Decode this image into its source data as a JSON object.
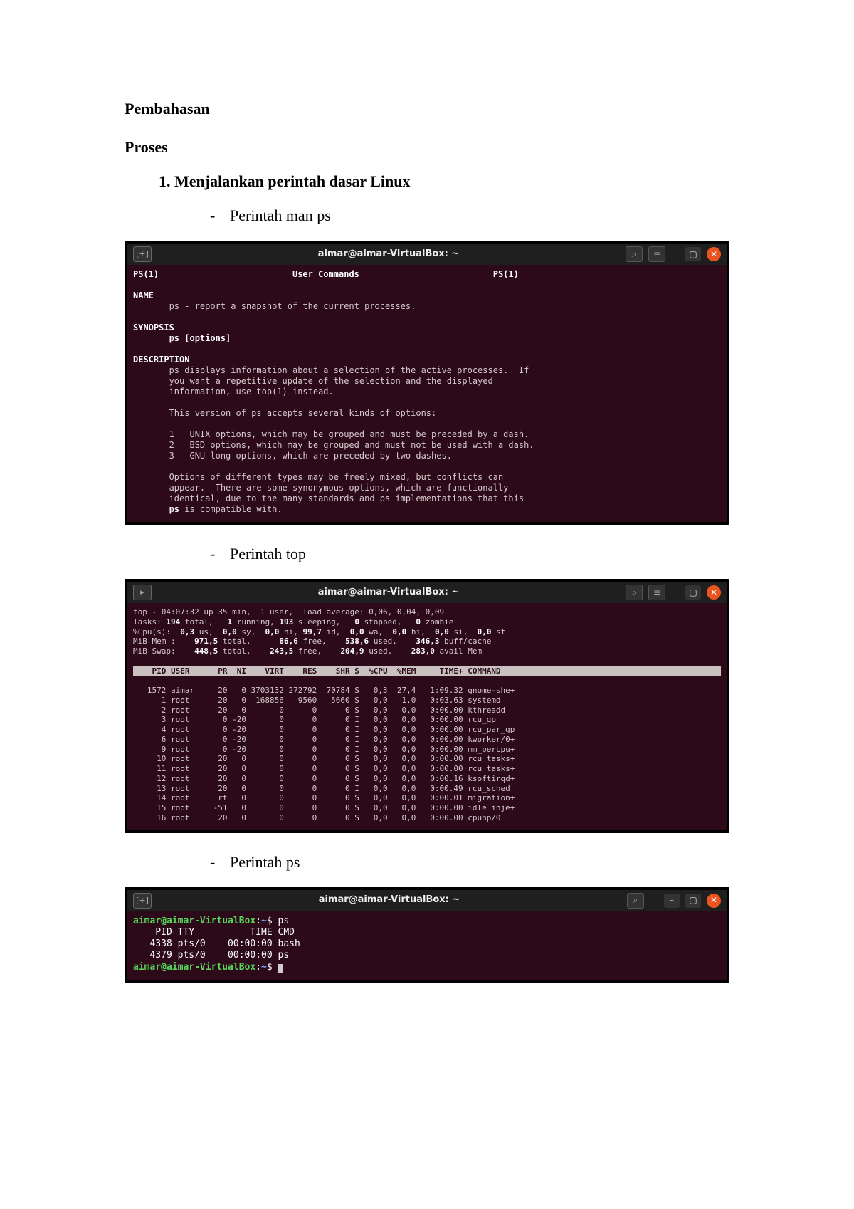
{
  "page": {
    "title": "Pembahasan",
    "subtitle": "Proses",
    "item1": "1.   Menjalankan perintah dasar Linux",
    "dash1": "Perintah man ps",
    "dash2": "Perintah top",
    "dash3": "Perintah ps"
  },
  "term1": {
    "title": "aimar@aimar-VirtualBox: ~",
    "left_icon": "[+]",
    "header_left": "PS(1)",
    "header_center": "User Commands",
    "header_right": "PS(1)",
    "sect_name": "NAME",
    "name_line": "       ps - report a snapshot of the current processes.",
    "sect_syn": "SYNOPSIS",
    "syn_line": "       ps [options]",
    "sect_desc": "DESCRIPTION",
    "desc_p1_l1": "       ps displays information about a selection of the active processes.  If",
    "desc_p1_l2": "       you want a repetitive update of the selection and the displayed",
    "desc_p1_l3": "       information, use top(1) instead.",
    "desc_p2": "       This version of ps accepts several kinds of options:",
    "opt1": "       1   UNIX options, which may be grouped and must be preceded by a dash.",
    "opt2": "       2   BSD options, which may be grouped and must not be used with a dash.",
    "opt3": "       3   GNU long options, which are preceded by two dashes.",
    "desc_p3_l1": "       Options of different types may be freely mixed, but conflicts can",
    "desc_p3_l2": "       appear.  There are some synonymous options, which are functionally",
    "desc_p3_l3": "       identical, due to the many standards and ps implementations that this",
    "desc_p3_l4": "       ps is compatible with."
  },
  "term2": {
    "title": "aimar@aimar-VirtualBox: ~",
    "left_icon": "▸",
    "line1": "top - 04:07:32 up 35 min,  1 user,  load average: 0,06, 0,04, 0,09",
    "line2_a": "Tasks: ",
    "line2_b": "194 ",
    "line2_c": "total,   ",
    "line2_d": "1 ",
    "line2_e": "running, ",
    "line2_f": "193 ",
    "line2_g": "sleeping,   ",
    "line2_h": "0 ",
    "line2_i": "stopped,   ",
    "line2_j": "0 ",
    "line2_k": "zombie",
    "line3_a": "%Cpu(s):  ",
    "line3_b": "0,3 ",
    "line3_c": "us,  ",
    "line3_d": "0,0 ",
    "line3_e": "sy,  ",
    "line3_f": "0,0 ",
    "line3_g": "ni, ",
    "line3_h": "99,7 ",
    "line3_i": "id,  ",
    "line3_j": "0,0 ",
    "line3_k": "wa,  ",
    "line3_l": "0,0 ",
    "line3_m": "hi,  ",
    "line3_n": "0,0 ",
    "line3_o": "si,  ",
    "line3_p": "0,0 ",
    "line3_q": "st",
    "line4_a": "MiB Mem :    ",
    "line4_b": "971,5 ",
    "line4_c": "total,      ",
    "line4_d": "86,6 ",
    "line4_e": "free,    ",
    "line4_f": "538,6 ",
    "line4_g": "used,    ",
    "line4_h": "346,3 ",
    "line4_i": "buff/cache",
    "line5_a": "MiB Swap:    ",
    "line5_b": "448,5 ",
    "line5_c": "total,    ",
    "line5_d": "243,5 ",
    "line5_e": "free,    ",
    "line5_f": "204,9 ",
    "line5_g": "used.    ",
    "line5_h": "283,0 ",
    "line5_i": "avail Mem",
    "cols": "    PID USER      PR  NI    VIRT    RES    SHR S  %CPU  %MEM     TIME+ COMMAND  ",
    "r1": "   1572 aimar     20   0 3703132 272792  70784 S   0,3  27,4   1:09.32 gnome-she+",
    "r2": "      1 root      20   0  168856   9560   5660 S   0,0   1,0   0:03.63 systemd   ",
    "r3": "      2 root      20   0       0      0      0 S   0,0   0,0   0:00.00 kthreadd  ",
    "r4": "      3 root       0 -20       0      0      0 I   0,0   0,0   0:00.00 rcu_gp    ",
    "r5": "      4 root       0 -20       0      0      0 I   0,0   0,0   0:00.00 rcu_par_gp",
    "r6": "      6 root       0 -20       0      0      0 I   0,0   0,0   0:00.00 kworker/0+",
    "r7": "      9 root       0 -20       0      0      0 I   0,0   0,0   0:00.00 mm_percpu+",
    "r8": "     10 root      20   0       0      0      0 S   0,0   0,0   0:00.00 rcu_tasks+",
    "r9": "     11 root      20   0       0      0      0 S   0,0   0,0   0:00.00 rcu_tasks+",
    "r10": "     12 root      20   0       0      0      0 S   0,0   0,0   0:00.16 ksoftirqd+",
    "r11": "     13 root      20   0       0      0      0 I   0,0   0,0   0:00.49 rcu_sched ",
    "r12": "     14 root      rt   0       0      0      0 S   0,0   0,0   0:00.01 migration+",
    "r13": "     15 root     -51   0       0      0      0 S   0,0   0,0   0:00.00 idle_inje+",
    "r14": "     16 root      20   0       0      0      0 S   0,0   0,0   0:00.00 cpuhp/0   "
  },
  "term3": {
    "title": "aimar@aimar-VirtualBox: ~",
    "left_icon": "[+]",
    "prompt_user": "aimar@aimar-VirtualBox",
    "prompt_sep": ":",
    "prompt_path": "~",
    "prompt_dollar": "$ ",
    "cmd": "ps",
    "hdr": "    PID TTY          TIME CMD",
    "out1": "   4338 pts/0    00:00:00 bash",
    "out2": "   4379 pts/0    00:00:00 ps"
  },
  "controls": {
    "search_glyph": "⌕",
    "menu_glyph": "≡",
    "min_glyph": "–",
    "max_glyph": "▢",
    "close_glyph": "✕"
  }
}
